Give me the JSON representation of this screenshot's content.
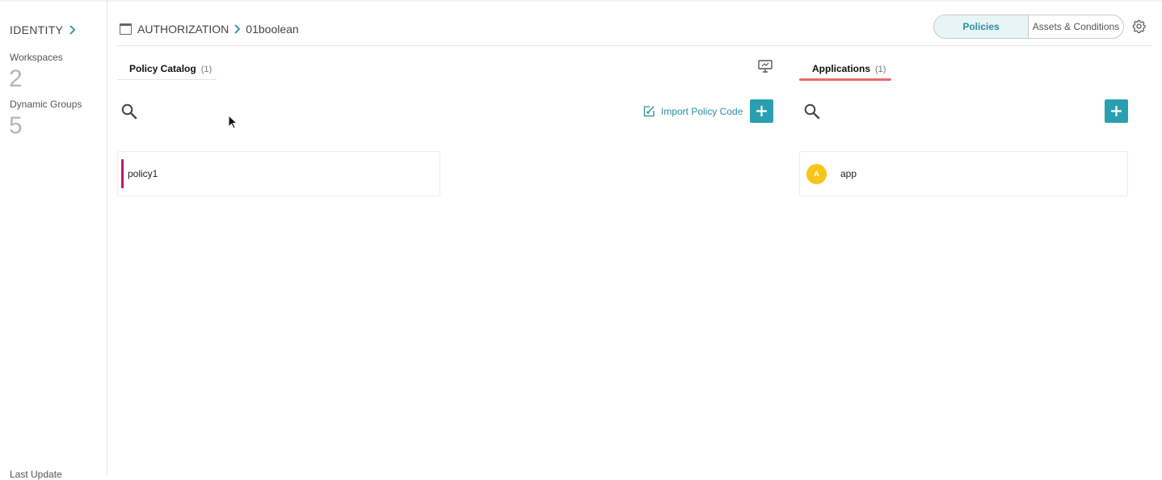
{
  "sidebar": {
    "title": "IDENTITY",
    "stats": [
      {
        "label": "Workspaces",
        "value": "2"
      },
      {
        "label": "Dynamic Groups",
        "value": "5"
      }
    ],
    "footer": "Last Update"
  },
  "breadcrumb": {
    "section": "AUTHORIZATION",
    "current": "01boolean"
  },
  "view_toggle": {
    "options": [
      "Policies",
      "Assets & Conditions"
    ],
    "selected": "Policies"
  },
  "policy_panel": {
    "tab_label": "Policy Catalog",
    "tab_count": "(1)",
    "import_label": "Import Policy Code",
    "items": [
      {
        "name": "policy1"
      }
    ]
  },
  "applications_panel": {
    "tab_label": "Applications",
    "tab_count": "(1)",
    "items": [
      {
        "initial": "A",
        "name": "app"
      }
    ]
  },
  "colors": {
    "accent": "#2a9fb0",
    "active_tab_underline": "#e86a6a",
    "policy_marker": "#c2186b",
    "avatar": "#f5c518"
  },
  "icons": [
    "chevron-right-icon",
    "window-icon",
    "gear-icon",
    "monitor-icon",
    "search-icon",
    "edit-import-icon",
    "plus-icon",
    "cursor-icon"
  ]
}
